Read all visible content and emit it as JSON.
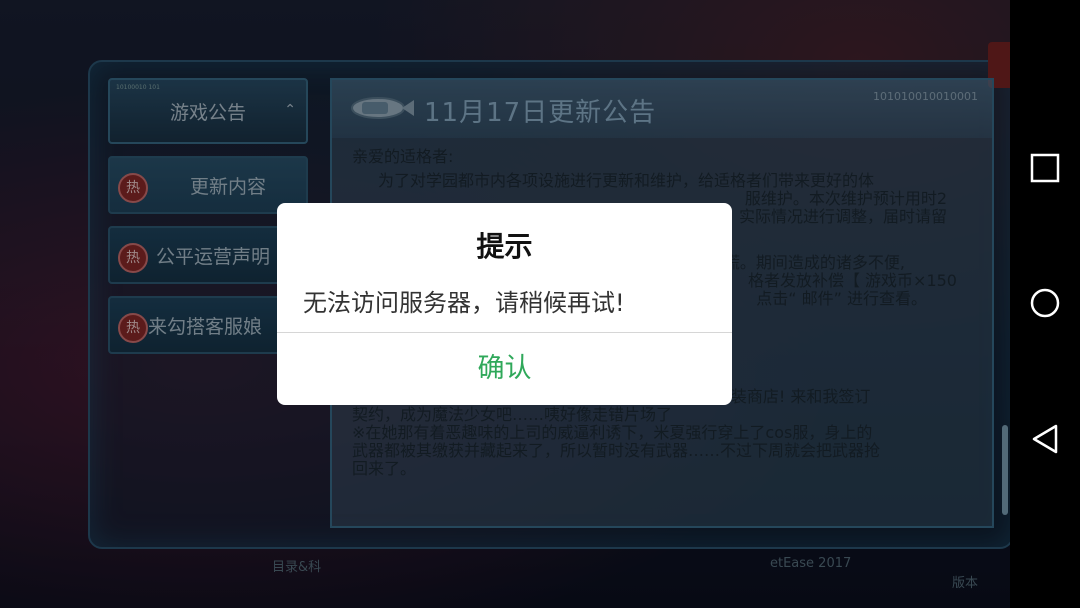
{
  "sidebar": {
    "header_label": "游戏公告",
    "header_code": "10100010 101",
    "hot_badge": "热",
    "items": [
      {
        "label": "更新内容"
      },
      {
        "label": "公平运营声明"
      },
      {
        "label": "来勾搭客服娘"
      }
    ]
  },
  "notice": {
    "title": "11月17日更新公告",
    "binary": "101010010010001",
    "greeting": "亲爱的适格者:",
    "line1": "为了对学园都市内各项设施进行更新和维护，给适格者们带来更好的体",
    "line2_tail": "服维护。本次维护预计用时2",
    "line3_tail": "实际情况进行调整，届时请留",
    "line4_tail": "慌。期间造成的诸多不便,",
    "line5_tail": "格者发放补偿【 游戏币×150",
    "line6_tail": "点击“ 邮件” 进行查看。",
    "item1_a": "1.真 · 马猴烧酒登场: 米夏、茵蒂克丝的COS服上架时装商店! 来和我签订",
    "item1_b": "契约，成为魔法少女吧……咦好像走错片场了",
    "note_a": "※在她那有着恶趣味的上司的威逼利诱下，米夏强行穿上了cos服，身上的",
    "note_b": "武器都被其缴获并藏起来了，所以暂时没有武器……不过下周就会把武器抢",
    "note_c": "回来了。"
  },
  "footer": {
    "left": "目录&科",
    "right": "etEase 2017",
    "version": "版本"
  },
  "dialog": {
    "title": "提示",
    "message": "无法访问服务器，请稍候再试!",
    "confirm": "确认"
  },
  "colors": {
    "confirm_text": "#2fa85a",
    "hot_badge": "#8c2a2a"
  },
  "icons": [
    "airship-icon",
    "chevron-up-icon",
    "square-icon",
    "circle-icon",
    "back-triangle-icon"
  ]
}
